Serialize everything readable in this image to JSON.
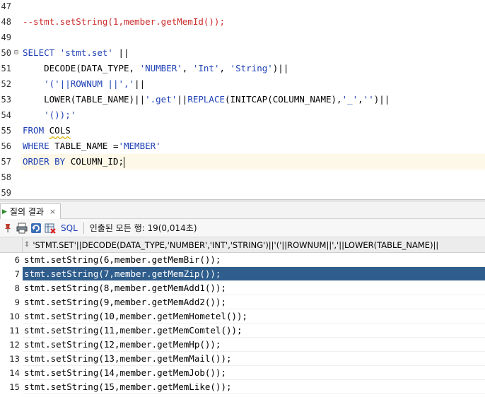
{
  "editor": {
    "lines": [
      {
        "num": "47",
        "fold": "",
        "segments": []
      },
      {
        "num": "48",
        "fold": "",
        "segments": [
          {
            "t": "--stmt.setString(1,member.getMemId());",
            "c": "cmt"
          }
        ]
      },
      {
        "num": "49",
        "fold": "",
        "segments": []
      },
      {
        "num": "50",
        "fold": "⊟",
        "segments": [
          {
            "t": "SELECT ",
            "c": "kw"
          },
          {
            "t": "'stmt.set'",
            "c": "str"
          },
          {
            "t": " ||",
            "c": "plain"
          }
        ]
      },
      {
        "num": "51",
        "fold": "",
        "segments": [
          {
            "t": "    DECODE(DATA_TYPE, ",
            "c": "plain"
          },
          {
            "t": "'NUMBER'",
            "c": "str"
          },
          {
            "t": ", ",
            "c": "plain"
          },
          {
            "t": "'Int'",
            "c": "str"
          },
          {
            "t": ", ",
            "c": "plain"
          },
          {
            "t": "'String'",
            "c": "str"
          },
          {
            "t": ")||",
            "c": "plain"
          }
        ]
      },
      {
        "num": "52",
        "fold": "",
        "segments": [
          {
            "t": "    ",
            "c": "plain"
          },
          {
            "t": "'('||ROWNUM ||','",
            "c": "str"
          },
          {
            "t": "||",
            "c": "plain"
          }
        ]
      },
      {
        "num": "53",
        "fold": "",
        "segments": [
          {
            "t": "    LOWER(TABLE_NAME)||",
            "c": "plain"
          },
          {
            "t": "'.get'",
            "c": "str"
          },
          {
            "t": "||",
            "c": "plain"
          },
          {
            "t": "REPLACE",
            "c": "kw"
          },
          {
            "t": "(INITCAP(COLUMN_NAME),",
            "c": "plain"
          },
          {
            "t": "'_'",
            "c": "str"
          },
          {
            "t": ",",
            "c": "plain"
          },
          {
            "t": "''",
            "c": "str"
          },
          {
            "t": ")||",
            "c": "plain"
          }
        ]
      },
      {
        "num": "54",
        "fold": "",
        "segments": [
          {
            "t": "    ",
            "c": "plain"
          },
          {
            "t": "'());'",
            "c": "str"
          }
        ]
      },
      {
        "num": "55",
        "fold": "",
        "segments": [
          {
            "t": "FROM ",
            "c": "kw"
          },
          {
            "t": "COLS",
            "c": "plain squig"
          }
        ]
      },
      {
        "num": "56",
        "fold": "",
        "segments": [
          {
            "t": "WHERE ",
            "c": "kw"
          },
          {
            "t": "TABLE_NAME =",
            "c": "plain"
          },
          {
            "t": "'MEMBER'",
            "c": "str"
          }
        ]
      },
      {
        "num": "57",
        "fold": "",
        "segments": [
          {
            "t": "ORDER BY ",
            "c": "kw"
          },
          {
            "t": "COLUMN_ID;",
            "c": "plain"
          }
        ],
        "current": true
      },
      {
        "num": "58",
        "fold": "",
        "segments": []
      },
      {
        "num": "59",
        "fold": "",
        "segments": []
      }
    ]
  },
  "results": {
    "tab_label": "질의 결과",
    "tab_close": "×",
    "toolbar": {
      "sql_label": "SQL",
      "separator": "|",
      "status_text": "인출된 모든 행: 19(0,014초)"
    },
    "column_header": "'STMT.SET'||DECODE(DATA_TYPE,'NUMBER','INT','STRING')||'('||ROWNUM||','||LOWER(TABLE_NAME)||",
    "rows": [
      {
        "num": "6",
        "value": "stmt.setString(6,member.getMemBir());"
      },
      {
        "num": "7",
        "value": "stmt.setString(7,member.getMemZip());",
        "selected": true
      },
      {
        "num": "8",
        "value": "stmt.setString(8,member.getMemAdd1());"
      },
      {
        "num": "9",
        "value": "stmt.setString(9,member.getMemAdd2());"
      },
      {
        "num": "10",
        "value": "stmt.setString(10,member.getMemHometel());"
      },
      {
        "num": "11",
        "value": "stmt.setString(11,member.getMemComtel());"
      },
      {
        "num": "12",
        "value": "stmt.setString(12,member.getMemHp());"
      },
      {
        "num": "13",
        "value": "stmt.setString(13,member.getMemMail());"
      },
      {
        "num": "14",
        "value": "stmt.setString(14,member.getMemJob());"
      },
      {
        "num": "15",
        "value": "stmt.setString(15,member.getMemLike());"
      }
    ]
  },
  "colors": {
    "keyword": "#1c3fb5",
    "comment": "#cc2b2b",
    "selection": "#2f5d8c",
    "current_line": "#fdf8e8"
  },
  "icons": [
    "pin-icon",
    "print-icon",
    "refresh-icon",
    "export-icon"
  ]
}
